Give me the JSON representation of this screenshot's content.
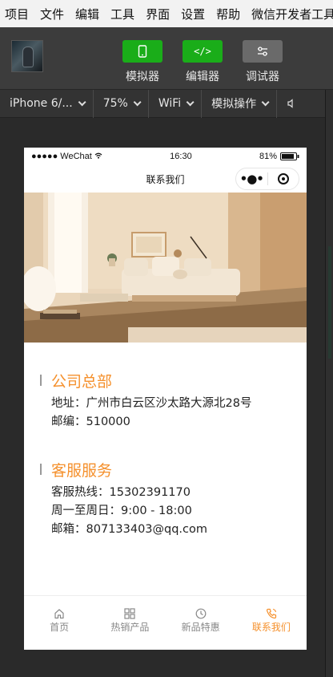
{
  "menubar": {
    "items": [
      "项目",
      "文件",
      "编辑",
      "工具",
      "界面",
      "设置",
      "帮助",
      "微信开发者工具"
    ]
  },
  "toolbar": {
    "simulator_label": "模拟器",
    "editor_label": "编辑器",
    "debugger_label": "调试器",
    "editor_icon": "</>"
  },
  "devbar": {
    "device": "iPhone 6/...",
    "zoom": "75%",
    "network": "WiFi",
    "operation": "模拟操作"
  },
  "phone": {
    "status": {
      "carrier": "●●●●● WeChat",
      "time": "16:30",
      "battery": "81%"
    },
    "nav_title": "联系我们",
    "capsule_dots": "•●•",
    "sections": [
      {
        "title": "公司总部",
        "lines": [
          "地址：广州市白云区沙太路大源北28号",
          "邮编：510000"
        ]
      },
      {
        "title": "客服服务",
        "lines": [
          "客服热线：15302391170",
          "周一至周日：9:00 - 18:00",
          "邮箱：807133403@qq.com"
        ]
      }
    ],
    "tabs": [
      {
        "label": "首页",
        "icon": "home-icon"
      },
      {
        "label": "热销产品",
        "icon": "grid-icon"
      },
      {
        "label": "新品特惠",
        "icon": "clock-icon"
      },
      {
        "label": "联系我们",
        "icon": "phone-icon"
      }
    ],
    "accent_color": "#f5902c"
  }
}
